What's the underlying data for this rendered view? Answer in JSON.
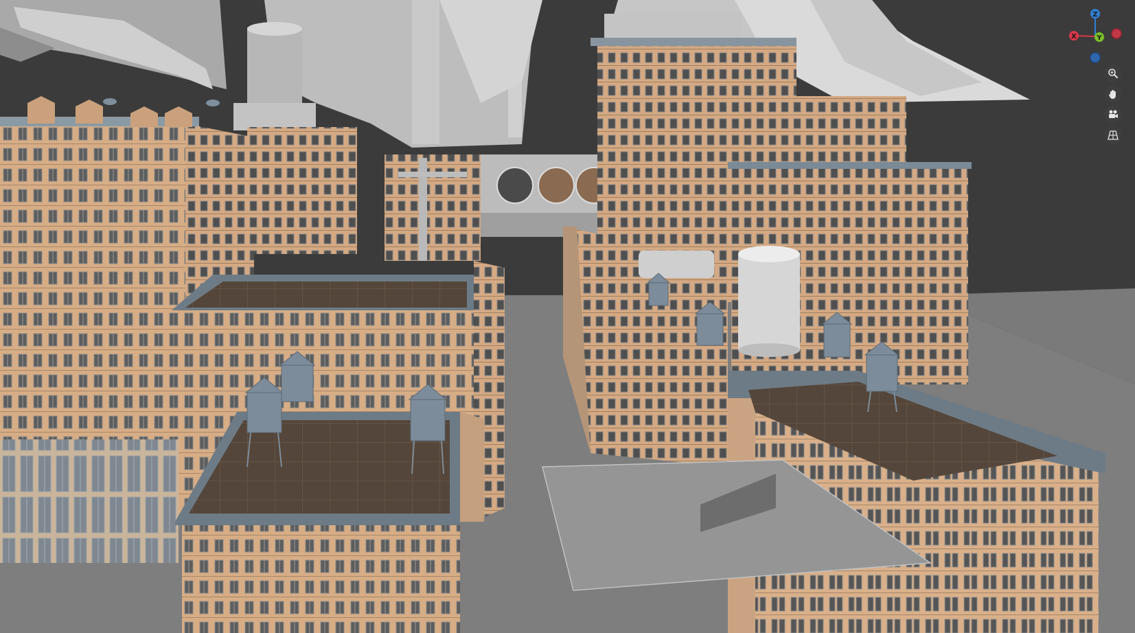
{
  "viewport": {
    "background": "#3b3b3b",
    "ground_color": "#7d7d7d",
    "brick_color": "#d9b08a",
    "roof_color": "#5a4a3c",
    "trim_color": "#6e7f8a",
    "tank_color": "#7d8c9a",
    "sculpt_color": "#b8b8b8"
  },
  "gizmo": {
    "axes": [
      {
        "label": "Z",
        "color": "#2f7fd6"
      },
      {
        "label": "X",
        "color": "#d9384a"
      },
      {
        "label": "Y",
        "color": "#7bbf2a"
      }
    ],
    "negative_colors": {
      "x": "#d9384a",
      "y": "#7bbf2a",
      "z": "#2f6fc0"
    }
  },
  "nav_buttons": [
    {
      "name": "zoom-icon"
    },
    {
      "name": "pan-hand-icon"
    },
    {
      "name": "camera-icon"
    },
    {
      "name": "ortho-grid-icon"
    }
  ]
}
